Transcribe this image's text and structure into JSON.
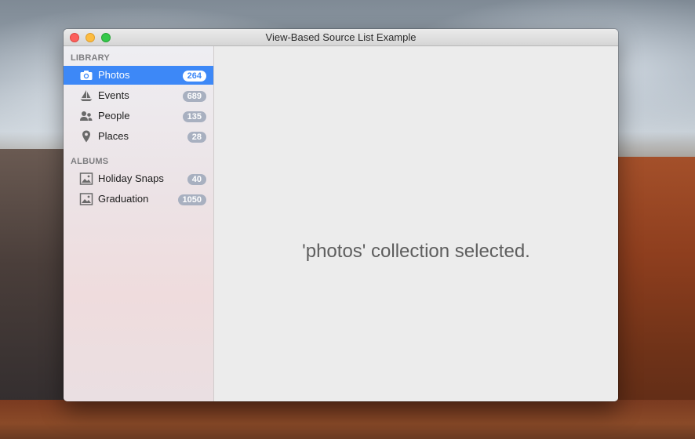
{
  "window": {
    "title": "View-Based Source List Example"
  },
  "sidebar": {
    "sections": [
      {
        "header": "LIBRARY",
        "items": [
          {
            "label": "Photos",
            "badge": "264",
            "icon": "camera-icon",
            "selected": true
          },
          {
            "label": "Events",
            "badge": "689",
            "icon": "sailboat-icon",
            "selected": false
          },
          {
            "label": "People",
            "badge": "135",
            "icon": "people-icon",
            "selected": false
          },
          {
            "label": "Places",
            "badge": "28",
            "icon": "map-pin-icon",
            "selected": false
          }
        ]
      },
      {
        "header": "ALBUMS",
        "items": [
          {
            "label": "Holiday Snaps",
            "badge": "40",
            "icon": "album-image-icon",
            "selected": false
          },
          {
            "label": "Graduation",
            "badge": "1050",
            "icon": "album-image-icon",
            "selected": false
          }
        ]
      }
    ],
    "footer": {
      "add_label": "+",
      "remove_label": "−"
    }
  },
  "content": {
    "message": "'photos' collection selected."
  },
  "colors": {
    "selection": "#3d88f7",
    "badge": "#a8b0c0"
  }
}
